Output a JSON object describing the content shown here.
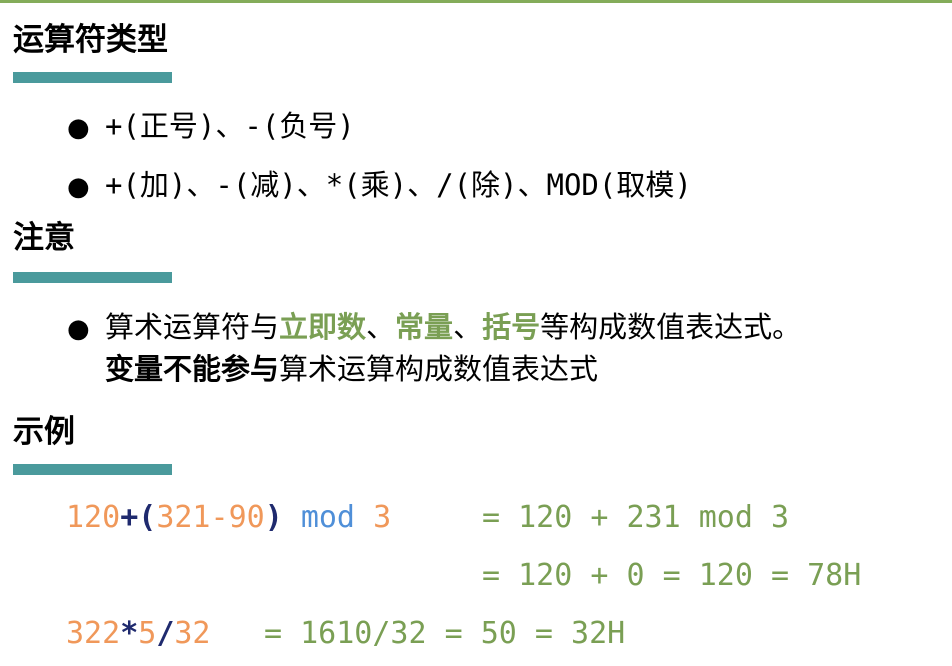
{
  "colors": {
    "accent_line": "#84ac5a",
    "underline": "#4a9a9c",
    "highlight_green": "#7a9f54",
    "number_orange": "#f0985a",
    "operator_navy": "#1f2a6e",
    "keyword_blue": "#4f8fd8"
  },
  "sections": {
    "types": {
      "title": "运算符类型",
      "items": [
        "+(正号)、-(负号)",
        "+(加)、-(减)、*(乘)、/(除)、MOD(取模)"
      ]
    },
    "note": {
      "title": "注意",
      "line1": {
        "t1": "算术运算符与",
        "g1": "立即数",
        "s1": "、",
        "g2": "常量",
        "s2": "、",
        "g3": "括号",
        "t2": "等构成数值表达式。"
      },
      "line2": {
        "bold": "变量不能参与",
        "rest": "算术运算构成数值表达式"
      }
    },
    "example": {
      "title": "示例",
      "line1": {
        "n1": "120",
        "p1": "+(",
        "n2": "321",
        "p2": "-",
        "n3": "90",
        "p3": ")",
        "kw": "mod",
        "n4": "3",
        "result": "= 120 + 231 mod 3"
      },
      "line2": {
        "result": "= 120 + 0 = 120 = 78H"
      },
      "line3": {
        "n1": "322",
        "p1": "*",
        "n2": "5",
        "p2": "/",
        "n3": "32",
        "result": "= 1610/32 = 50 = 32H"
      }
    }
  }
}
